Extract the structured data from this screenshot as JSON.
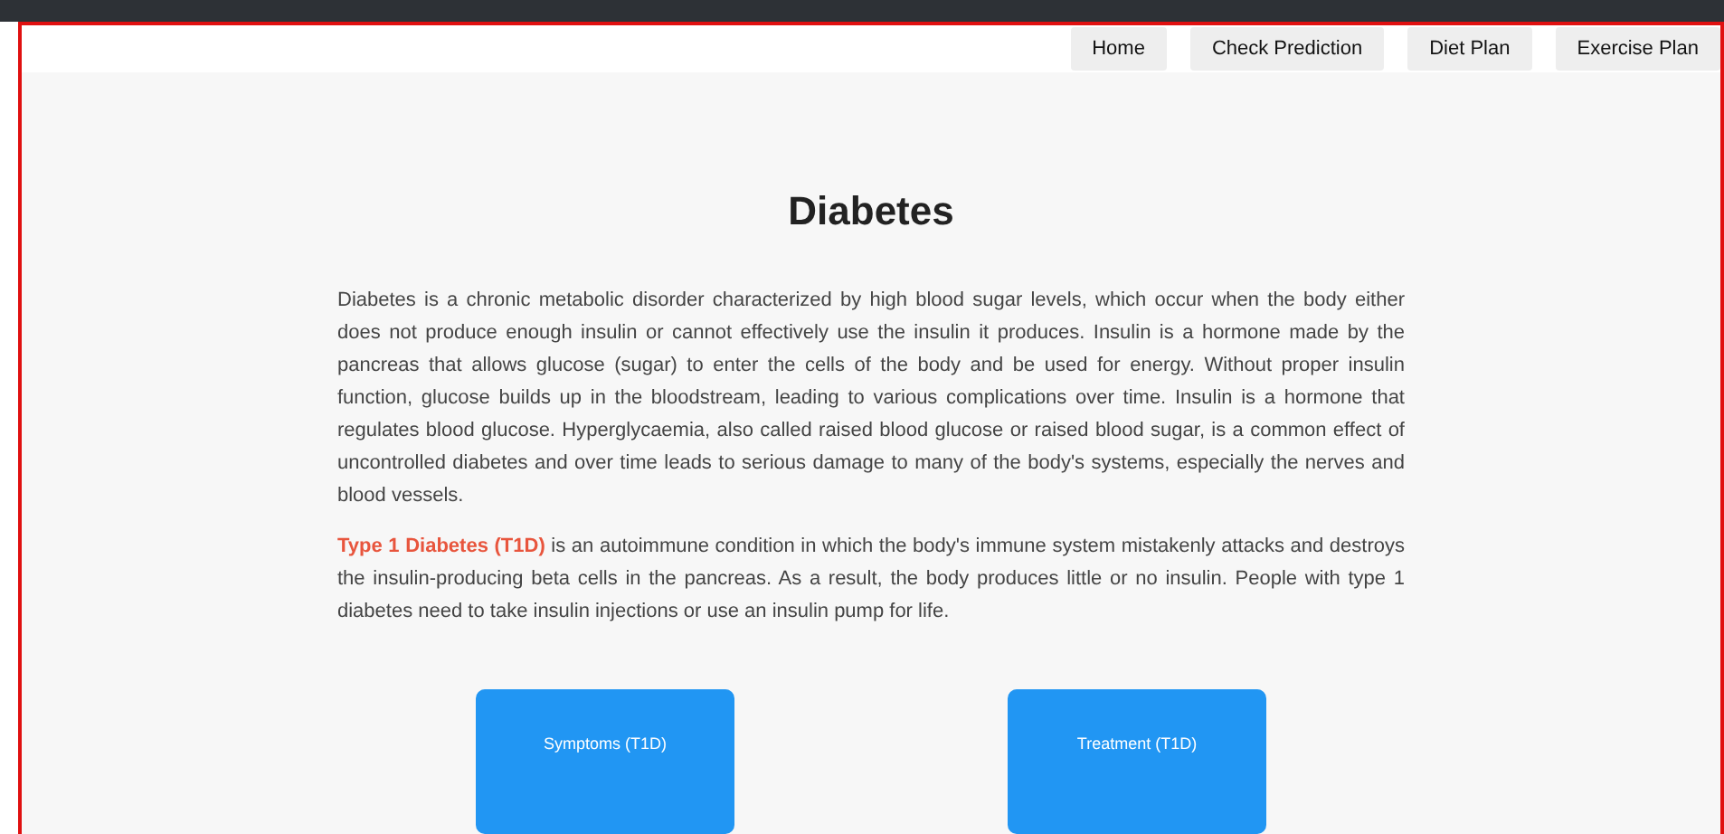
{
  "nav": [
    {
      "label": "Home"
    },
    {
      "label": "Check Prediction"
    },
    {
      "label": "Diet Plan"
    },
    {
      "label": "Exercise Plan"
    }
  ],
  "title": "Diabetes",
  "paragraphs": [
    "Diabetes is a chronic metabolic disorder characterized by high blood sugar levels, which occur when the body either does not produce enough insulin or cannot effectively use the insulin it produces. Insulin is a hormone made by the pancreas that allows glucose (sugar) to enter the cells of the body and be used for energy. Without proper insulin function, glucose builds up in the bloodstream, leading to various complications over time. Insulin is a hormone that regulates blood glucose. Hyperglycaemia, also called raised blood glucose or raised blood sugar, is a common effect of uncontrolled diabetes and over time leads to serious damage to many of the body's systems, especially the nerves and blood vessels.",
    "**Type 1 Diabetes (T1D)** is an autoimmune condition in which the body's immune system mistakenly attacks and destroys the insulin-producing beta cells in the pancreas. As a result, the body produces little or no insulin. People with type 1 diabetes need to take insulin injections or use an insulin pump for life."
  ],
  "cards": [
    {
      "label": "Symptoms (T1D)"
    },
    {
      "label": "Treatment (T1D)"
    }
  ]
}
